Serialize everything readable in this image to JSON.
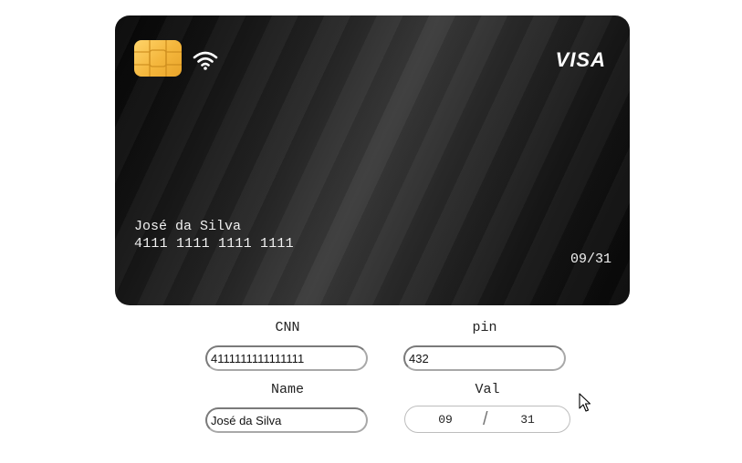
{
  "card": {
    "brand": "VISA",
    "holder_name": "José da Silva",
    "number": "4111 1111 1111 1111",
    "expiry": "09/31",
    "chip_icon": "chip-icon",
    "contactless_icon": "wifi-icon"
  },
  "form": {
    "cnn": {
      "label": "CNN",
      "value": "4111111111111111"
    },
    "pin": {
      "label": "pin",
      "value": "432"
    },
    "name": {
      "label": "Name",
      "value": "José da Silva"
    },
    "val": {
      "label": "Val",
      "month": "09",
      "separator": "/",
      "year": "31"
    }
  },
  "colors": {
    "chip": "#f4b63c",
    "card_text": "#f1f1f1",
    "card_dark": "#050505",
    "card_light": "#3a3a3a"
  }
}
